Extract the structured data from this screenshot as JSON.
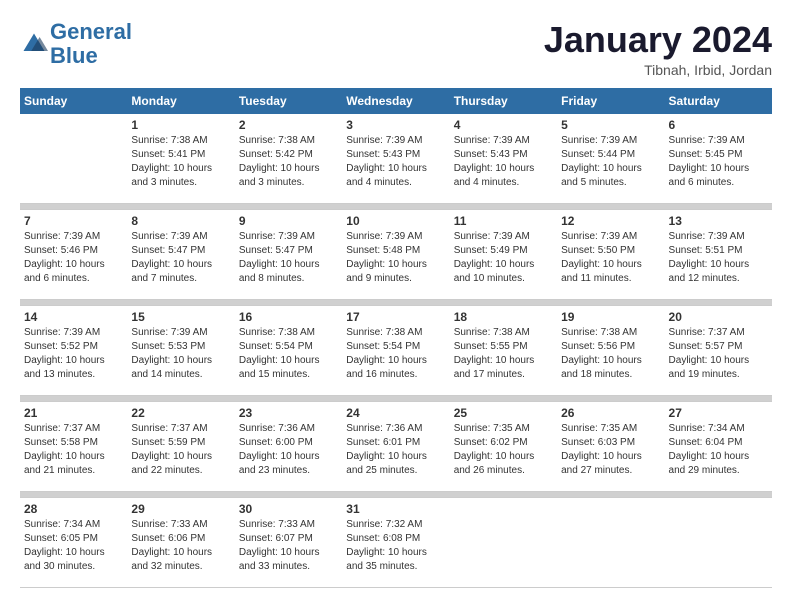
{
  "header": {
    "logo_line1": "General",
    "logo_line2": "Blue",
    "title": "January 2024",
    "subtitle": "Tibnah, Irbid, Jordan"
  },
  "columns": [
    "Sunday",
    "Monday",
    "Tuesday",
    "Wednesday",
    "Thursday",
    "Friday",
    "Saturday"
  ],
  "weeks": [
    {
      "days": [
        {
          "number": "",
          "sunrise": "",
          "sunset": "",
          "daylight": ""
        },
        {
          "number": "1",
          "sunrise": "Sunrise: 7:38 AM",
          "sunset": "Sunset: 5:41 PM",
          "daylight": "Daylight: 10 hours and 3 minutes."
        },
        {
          "number": "2",
          "sunrise": "Sunrise: 7:38 AM",
          "sunset": "Sunset: 5:42 PM",
          "daylight": "Daylight: 10 hours and 3 minutes."
        },
        {
          "number": "3",
          "sunrise": "Sunrise: 7:39 AM",
          "sunset": "Sunset: 5:43 PM",
          "daylight": "Daylight: 10 hours and 4 minutes."
        },
        {
          "number": "4",
          "sunrise": "Sunrise: 7:39 AM",
          "sunset": "Sunset: 5:43 PM",
          "daylight": "Daylight: 10 hours and 4 minutes."
        },
        {
          "number": "5",
          "sunrise": "Sunrise: 7:39 AM",
          "sunset": "Sunset: 5:44 PM",
          "daylight": "Daylight: 10 hours and 5 minutes."
        },
        {
          "number": "6",
          "sunrise": "Sunrise: 7:39 AM",
          "sunset": "Sunset: 5:45 PM",
          "daylight": "Daylight: 10 hours and 6 minutes."
        }
      ]
    },
    {
      "days": [
        {
          "number": "7",
          "sunrise": "Sunrise: 7:39 AM",
          "sunset": "Sunset: 5:46 PM",
          "daylight": "Daylight: 10 hours and 6 minutes."
        },
        {
          "number": "8",
          "sunrise": "Sunrise: 7:39 AM",
          "sunset": "Sunset: 5:47 PM",
          "daylight": "Daylight: 10 hours and 7 minutes."
        },
        {
          "number": "9",
          "sunrise": "Sunrise: 7:39 AM",
          "sunset": "Sunset: 5:47 PM",
          "daylight": "Daylight: 10 hours and 8 minutes."
        },
        {
          "number": "10",
          "sunrise": "Sunrise: 7:39 AM",
          "sunset": "Sunset: 5:48 PM",
          "daylight": "Daylight: 10 hours and 9 minutes."
        },
        {
          "number": "11",
          "sunrise": "Sunrise: 7:39 AM",
          "sunset": "Sunset: 5:49 PM",
          "daylight": "Daylight: 10 hours and 10 minutes."
        },
        {
          "number": "12",
          "sunrise": "Sunrise: 7:39 AM",
          "sunset": "Sunset: 5:50 PM",
          "daylight": "Daylight: 10 hours and 11 minutes."
        },
        {
          "number": "13",
          "sunrise": "Sunrise: 7:39 AM",
          "sunset": "Sunset: 5:51 PM",
          "daylight": "Daylight: 10 hours and 12 minutes."
        }
      ]
    },
    {
      "days": [
        {
          "number": "14",
          "sunrise": "Sunrise: 7:39 AM",
          "sunset": "Sunset: 5:52 PM",
          "daylight": "Daylight: 10 hours and 13 minutes."
        },
        {
          "number": "15",
          "sunrise": "Sunrise: 7:39 AM",
          "sunset": "Sunset: 5:53 PM",
          "daylight": "Daylight: 10 hours and 14 minutes."
        },
        {
          "number": "16",
          "sunrise": "Sunrise: 7:38 AM",
          "sunset": "Sunset: 5:54 PM",
          "daylight": "Daylight: 10 hours and 15 minutes."
        },
        {
          "number": "17",
          "sunrise": "Sunrise: 7:38 AM",
          "sunset": "Sunset: 5:54 PM",
          "daylight": "Daylight: 10 hours and 16 minutes."
        },
        {
          "number": "18",
          "sunrise": "Sunrise: 7:38 AM",
          "sunset": "Sunset: 5:55 PM",
          "daylight": "Daylight: 10 hours and 17 minutes."
        },
        {
          "number": "19",
          "sunrise": "Sunrise: 7:38 AM",
          "sunset": "Sunset: 5:56 PM",
          "daylight": "Daylight: 10 hours and 18 minutes."
        },
        {
          "number": "20",
          "sunrise": "Sunrise: 7:37 AM",
          "sunset": "Sunset: 5:57 PM",
          "daylight": "Daylight: 10 hours and 19 minutes."
        }
      ]
    },
    {
      "days": [
        {
          "number": "21",
          "sunrise": "Sunrise: 7:37 AM",
          "sunset": "Sunset: 5:58 PM",
          "daylight": "Daylight: 10 hours and 21 minutes."
        },
        {
          "number": "22",
          "sunrise": "Sunrise: 7:37 AM",
          "sunset": "Sunset: 5:59 PM",
          "daylight": "Daylight: 10 hours and 22 minutes."
        },
        {
          "number": "23",
          "sunrise": "Sunrise: 7:36 AM",
          "sunset": "Sunset: 6:00 PM",
          "daylight": "Daylight: 10 hours and 23 minutes."
        },
        {
          "number": "24",
          "sunrise": "Sunrise: 7:36 AM",
          "sunset": "Sunset: 6:01 PM",
          "daylight": "Daylight: 10 hours and 25 minutes."
        },
        {
          "number": "25",
          "sunrise": "Sunrise: 7:35 AM",
          "sunset": "Sunset: 6:02 PM",
          "daylight": "Daylight: 10 hours and 26 minutes."
        },
        {
          "number": "26",
          "sunrise": "Sunrise: 7:35 AM",
          "sunset": "Sunset: 6:03 PM",
          "daylight": "Daylight: 10 hours and 27 minutes."
        },
        {
          "number": "27",
          "sunrise": "Sunrise: 7:34 AM",
          "sunset": "Sunset: 6:04 PM",
          "daylight": "Daylight: 10 hours and 29 minutes."
        }
      ]
    },
    {
      "days": [
        {
          "number": "28",
          "sunrise": "Sunrise: 7:34 AM",
          "sunset": "Sunset: 6:05 PM",
          "daylight": "Daylight: 10 hours and 30 minutes."
        },
        {
          "number": "29",
          "sunrise": "Sunrise: 7:33 AM",
          "sunset": "Sunset: 6:06 PM",
          "daylight": "Daylight: 10 hours and 32 minutes."
        },
        {
          "number": "30",
          "sunrise": "Sunrise: 7:33 AM",
          "sunset": "Sunset: 6:07 PM",
          "daylight": "Daylight: 10 hours and 33 minutes."
        },
        {
          "number": "31",
          "sunrise": "Sunrise: 7:32 AM",
          "sunset": "Sunset: 6:08 PM",
          "daylight": "Daylight: 10 hours and 35 minutes."
        },
        {
          "number": "",
          "sunrise": "",
          "sunset": "",
          "daylight": ""
        },
        {
          "number": "",
          "sunrise": "",
          "sunset": "",
          "daylight": ""
        },
        {
          "number": "",
          "sunrise": "",
          "sunset": "",
          "daylight": ""
        }
      ]
    }
  ]
}
